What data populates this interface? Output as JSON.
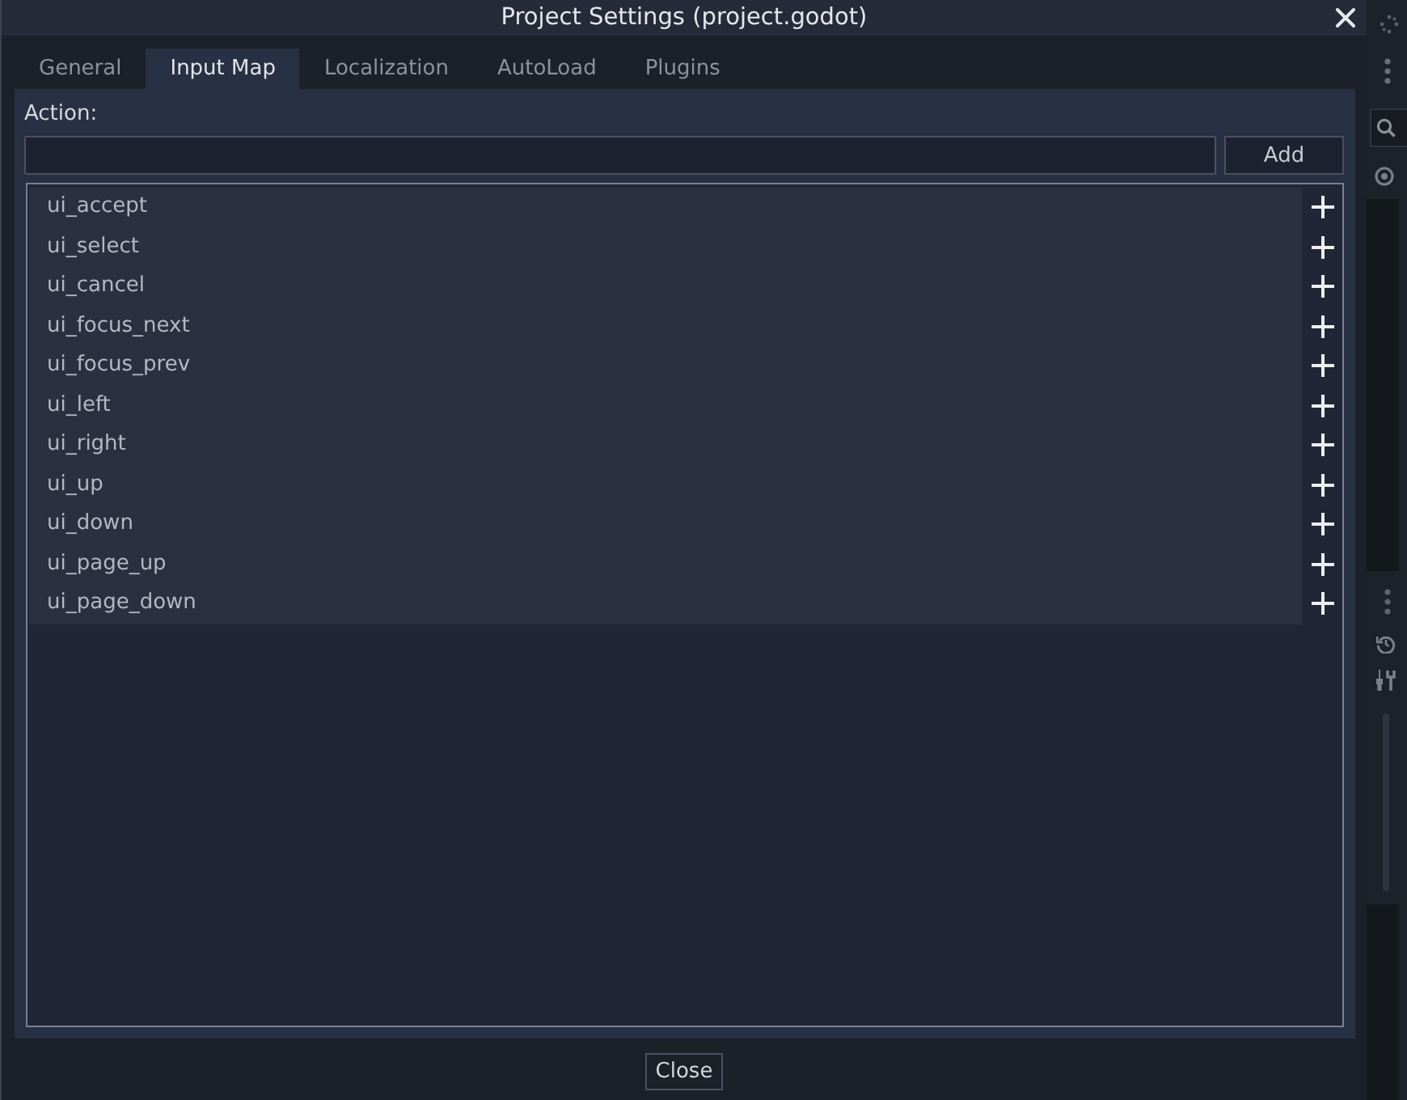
{
  "window": {
    "title": "Project Settings (project.godot)"
  },
  "tabs": [
    {
      "label": "General",
      "selected": false
    },
    {
      "label": "Input Map",
      "selected": true
    },
    {
      "label": "Localization",
      "selected": false
    },
    {
      "label": "AutoLoad",
      "selected": false
    },
    {
      "label": "Plugins",
      "selected": false
    }
  ],
  "action_bar": {
    "label": "Action:",
    "add_button": "Add"
  },
  "actions": [
    {
      "name": "ui_accept"
    },
    {
      "name": "ui_select"
    },
    {
      "name": "ui_cancel"
    },
    {
      "name": "ui_focus_next"
    },
    {
      "name": "ui_focus_prev"
    },
    {
      "name": "ui_left"
    },
    {
      "name": "ui_right"
    },
    {
      "name": "ui_up"
    },
    {
      "name": "ui_down"
    },
    {
      "name": "ui_page_up"
    },
    {
      "name": "ui_page_down"
    }
  ],
  "footer": {
    "close_button": "Close"
  }
}
